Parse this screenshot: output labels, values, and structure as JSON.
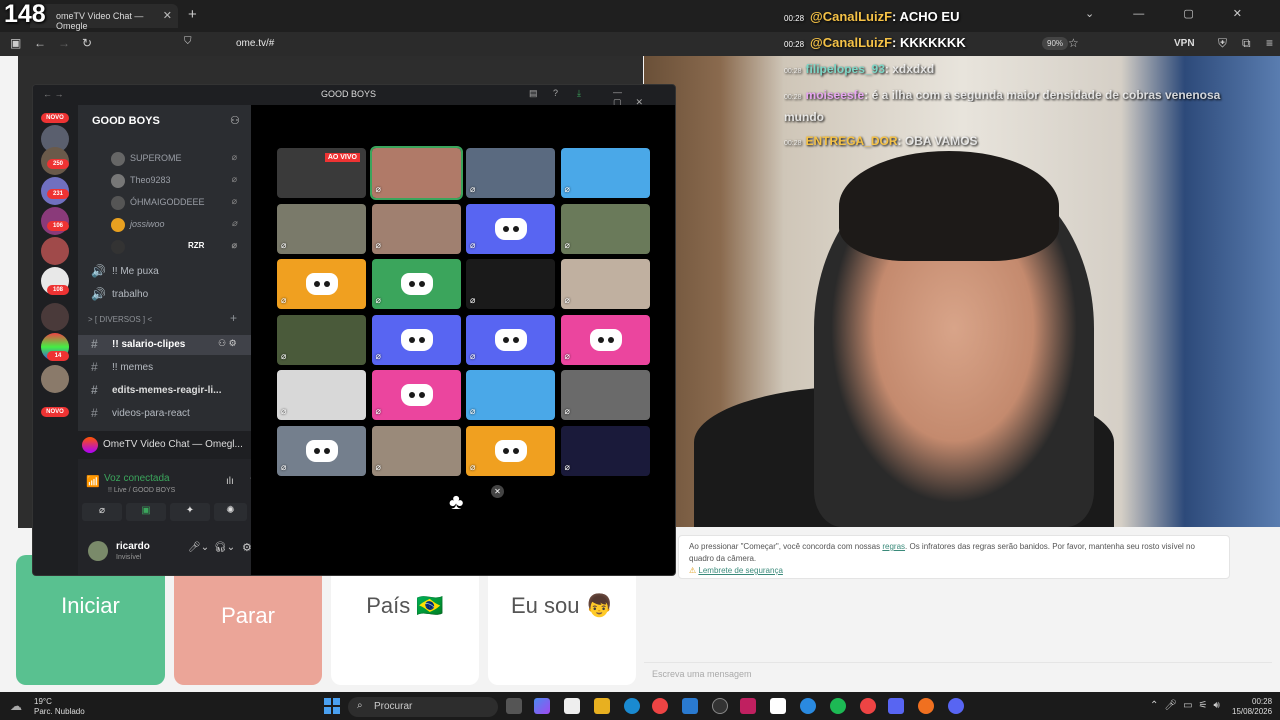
{
  "stream_counter": "148",
  "browser": {
    "tab_title": "omeTV Video Chat — Omegle",
    "url": "ome.tv/#",
    "zoom": "90%",
    "vpn": "VPN"
  },
  "stream_chat": [
    {
      "time": "00:28",
      "user": "@CanalLuizF",
      "text": ": ACHO EU"
    },
    {
      "time": "00:28",
      "user": "@CanalLuizF",
      "text": ": KKKKKKK"
    }
  ],
  "stream_chat_dim": [
    {
      "time": "00:28",
      "user": "filipelopes_93",
      "text": ": xdxdxd"
    },
    {
      "time": "00:28",
      "user": "moiseesfe",
      "text": ": é a ilha com a segunda maior densidade de cobras venenosa"
    },
    {
      "text": "mundo"
    },
    {
      "time": "00:28",
      "user": "ENTREGA_DOR",
      "text": ": OBA VAMOS"
    }
  ],
  "discord": {
    "window_title": "GOOD BOYS",
    "server_name": "GOOD BOYS",
    "badges": [
      "NOVO",
      "250",
      "231",
      "106",
      "108",
      "14",
      "NOVO"
    ],
    "voice_users": [
      "SUPEROME",
      "Theo9283",
      "ÓHMAIGODDEEE",
      "jossiwoo",
      "RZR"
    ],
    "channels": [
      {
        "name": "!! Me puxa",
        "type": "voice"
      },
      {
        "name": "trabalho",
        "type": "voice"
      },
      {
        "name": "> [ DIVERSOS ] <",
        "type": "category"
      },
      {
        "name": "!! salario-clipes",
        "type": "text",
        "selected": true
      },
      {
        "name": "!! memes",
        "type": "text"
      },
      {
        "name": "edits-memes-reagir-li...",
        "type": "text"
      },
      {
        "name": "videos-para-react",
        "type": "text"
      }
    ],
    "activity": "OmeTV Video Chat — Omegl...",
    "voice_status": "Voz conectada",
    "voice_channel": "!! Live / GOOD BOYS",
    "user_name": "ricardo",
    "user_status": "Invisível",
    "live_badge": "AO VIVO",
    "tile_colors": [
      "#3a3a3a",
      "#b07a68",
      "#5a6a80",
      "#4aa8e8",
      "#7a7a6a",
      "#a08070",
      "#5865f2",
      "#6a7a5a",
      "#f0a020",
      "#3ba55c",
      "#1a1a1a",
      "#c0b0a0",
      "#4a5a3a",
      "#5865f2",
      "#5865f2",
      "#eb459e",
      "#d8d8d8",
      "#eb459e",
      "#4aa8e8",
      "#6a6a6a",
      "#747f8d",
      "#9a8a7a",
      "#f0a020",
      "#1a1a3a"
    ],
    "discord_logo_tiles": [
      6,
      8,
      9,
      13,
      14,
      15,
      17,
      20,
      22
    ]
  },
  "ometv": {
    "notice_text": "Ao pressionar \"Começar\", você concorda com nossas",
    "notice_link": "regras",
    "notice_text2": ". Os infratores das regras serão banidos. Por favor, mantenha seu rosto visível no quadro da câmera.",
    "safety_link": "Lembrete de segurança",
    "btn_start": "Iniciar",
    "btn_stop": "Parar",
    "btn_country": "País 🇧🇷",
    "btn_me": "Eu sou 👦",
    "message_placeholder": "Escreva uma mensagem"
  },
  "taskbar": {
    "weather_temp": "19°C",
    "weather_desc": "Parc. Nublado",
    "search_placeholder": "Procurar",
    "time": "00:28",
    "date": "15/08/2026"
  }
}
